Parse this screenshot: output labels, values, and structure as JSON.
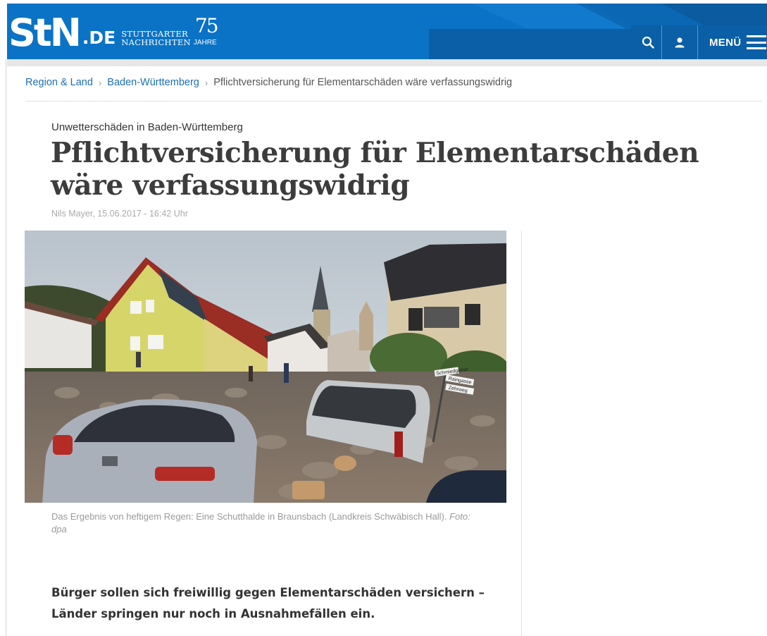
{
  "header": {
    "logo_main": "StN",
    "logo_domain": ".DE",
    "logo_name_line1": "STUTTGARTER",
    "logo_name_line2": "NACHRICHTEN",
    "logo_years": "75",
    "logo_years_label": "JAHRE",
    "search_icon": "search-icon",
    "user_icon": "user-icon",
    "menu_label": "MENÜ",
    "menu_icon": "hamburger-icon",
    "brand_color": "#0a73c6"
  },
  "breadcrumb": {
    "items": [
      "Region & Land",
      "Baden-Württemberg"
    ],
    "separator": "›",
    "current": "Pflichtversicherung für Elementarschäden wäre verfassungswidrig"
  },
  "article": {
    "kicker": "Unwetterschäden in Baden-Württemberg",
    "headline_line1": "Pflichtversicherung für Elementarschäden",
    "headline_line2": "wäre verfassungswidrig",
    "byline": "Nils Mayer,  15.06.2017 - 16:42 Uhr",
    "caption_text": "Das Ergebnis von heftigem Regen: Eine Schutthalde in Braunsbach (Landkreis Schwäbisch Hall).",
    "caption_credit": "Foto: dpa",
    "lead_line1": "Bürger sollen sich freiwillig gegen Elementarschäden versichern –",
    "lead_line2": "Länder springen nur noch in Ausnahmefällen ein.",
    "photo_signs": [
      "Schmiedgasse",
      "Raingasse",
      "Zehrweg"
    ]
  }
}
